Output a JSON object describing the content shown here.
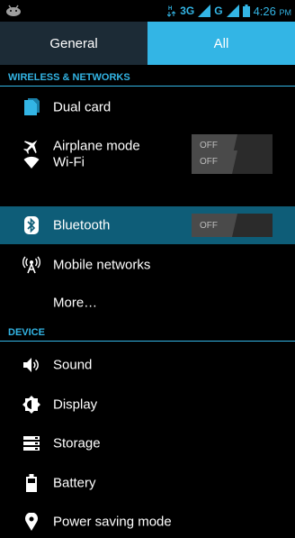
{
  "status_bar": {
    "network_type": "3G",
    "second_network": "G",
    "time": "4:26",
    "ampm": "PM",
    "icons": [
      "android-notification-icon",
      "data-transfer-icon",
      "signal-3g-icon",
      "signal-g-icon",
      "battery-icon"
    ]
  },
  "tabs": [
    {
      "label": "General",
      "selected": false
    },
    {
      "label": "All",
      "selected": true
    }
  ],
  "sections": {
    "wireless": {
      "title": "WIRELESS & NETWORKS"
    },
    "device": {
      "title": "DEVICE"
    }
  },
  "items": {
    "dual_card": {
      "label": "Dual card",
      "icon": "sim-card-icon"
    },
    "airplane": {
      "label": "Airplane mode",
      "icon": "airplane-icon",
      "toggle": "OFF"
    },
    "wifi": {
      "label": "Wi-Fi",
      "icon": "wifi-icon",
      "toggle": "OFF"
    },
    "bluetooth": {
      "label": "Bluetooth",
      "icon": "bluetooth-icon",
      "toggle": "OFF",
      "selected": true
    },
    "mobile_networks": {
      "label": "Mobile networks",
      "icon": "antenna-icon"
    },
    "more": {
      "label": "More…"
    },
    "sound": {
      "label": "Sound",
      "icon": "speaker-icon"
    },
    "display": {
      "label": "Display",
      "icon": "brightness-icon"
    },
    "storage": {
      "label": "Storage",
      "icon": "storage-icon"
    },
    "battery": {
      "label": "Battery",
      "icon": "battery-icon"
    },
    "power_saving": {
      "label": "Power saving mode",
      "icon": "location-pin-icon"
    }
  },
  "colors": {
    "accent": "#33b5e5",
    "tab_inactive": "#1c2b36",
    "selected_row": "#0e5d78",
    "background": "#000000"
  }
}
